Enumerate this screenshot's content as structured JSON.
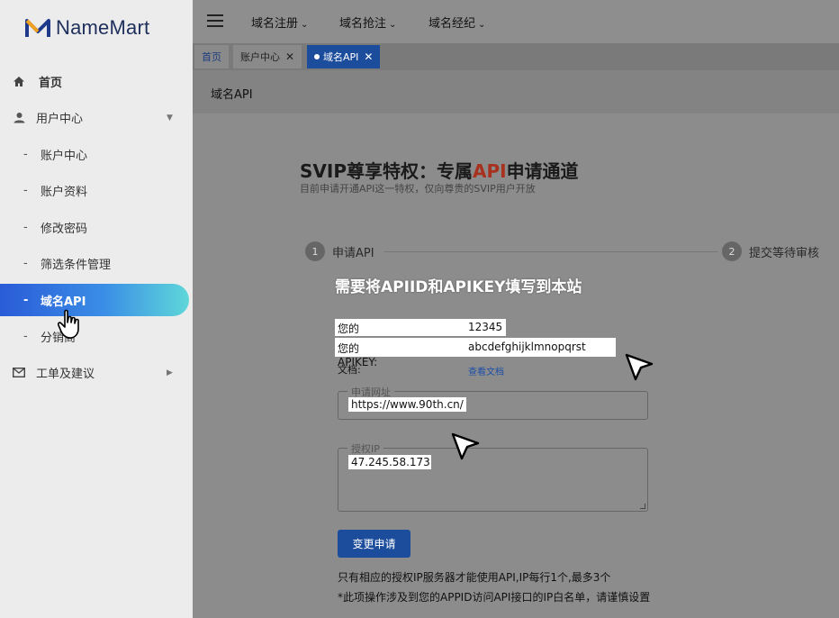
{
  "brand": {
    "name": "NameMart"
  },
  "sidebar": {
    "items": [
      {
        "label": "首页",
        "icon": "home-icon"
      },
      {
        "label": "用户中心",
        "icon": "user-icon"
      },
      {
        "label": "账户中心"
      },
      {
        "label": "账户资料"
      },
      {
        "label": "修改密码"
      },
      {
        "label": "筛选条件管理"
      },
      {
        "label": "域名API"
      },
      {
        "label": "分销商"
      },
      {
        "label": "工单及建议",
        "icon": "mail-icon"
      }
    ],
    "dash": "-"
  },
  "topbar": {
    "menus": [
      {
        "label": "域名注册"
      },
      {
        "label": "域名抢注"
      },
      {
        "label": "域名经纪"
      }
    ]
  },
  "tabs": [
    {
      "label": "首页"
    },
    {
      "label": "账户中心"
    },
    {
      "label": "域名API"
    }
  ],
  "page": {
    "title": "域名API"
  },
  "main": {
    "title_prefix": "SVIP尊享特权：专属",
    "title_highlight": "API",
    "title_suffix": "申请通道",
    "subtitle": "目前申请开通API这一特权，仅向尊贵的SVIP用户开放",
    "steps": [
      {
        "num": "1",
        "label": "申请API"
      },
      {
        "num": "2",
        "label": "提交等待审核"
      }
    ],
    "notice": "需要将APIID和APIKEY填写到本站",
    "apiid_label": "您的APIID:",
    "apiid_value": "12345",
    "apikey_label": "您的APIKEY:",
    "apikey_value": "abcdefghijklmnopqrst",
    "doc_label": "文档:",
    "doc_link": "查看文档",
    "url_legend": "申请网址",
    "url_value": "https://www.90th.cn/",
    "ip_legend": "授权IP",
    "ip_value": "47.245.58.173",
    "submit_label": "变更申请",
    "footnote1": "只有相应的授权IP服务器才能使用API,IP每行1个,最多3个",
    "footnote2": "*此项操作涉及到您的APPID访问API接口的IP白名单，请谨慎设置"
  },
  "colors": {
    "accent": "#1c4d9c",
    "highlight": "#a8311e",
    "active_gradient_start": "#2a5bd8",
    "active_gradient_end": "#5fd7d9"
  }
}
